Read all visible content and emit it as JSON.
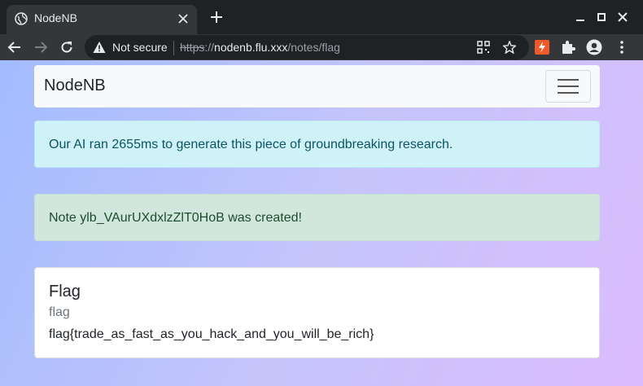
{
  "browser": {
    "tab": {
      "title": "NodeNB",
      "favicon": "globe-icon"
    },
    "address_bar": {
      "security_label": "Not secure",
      "url_scheme": "https",
      "url_separator": "://",
      "url_host": "nodenb.flu.xxx",
      "url_path": "/notes/flag"
    }
  },
  "navbar": {
    "brand": "NodeNB"
  },
  "alerts": {
    "info": "Our AI ran 2655ms to generate this piece of groundbreaking research.",
    "success": "Note ylb_VAurUXdxlzZlT0HoB was created!"
  },
  "note": {
    "title": "Flag",
    "subtitle": "flag",
    "body": "flag{trade_as_fast_as_you_hack_and_you_will_be_rich}"
  },
  "colors": {
    "chrome_dark": "#202124",
    "chrome_toolbar": "#35363a",
    "alert_info_bg": "#cff1f8",
    "alert_success_bg": "#d1e7dd",
    "gradient_start": "#a3bcff",
    "gradient_end": "#dcbcfe"
  }
}
